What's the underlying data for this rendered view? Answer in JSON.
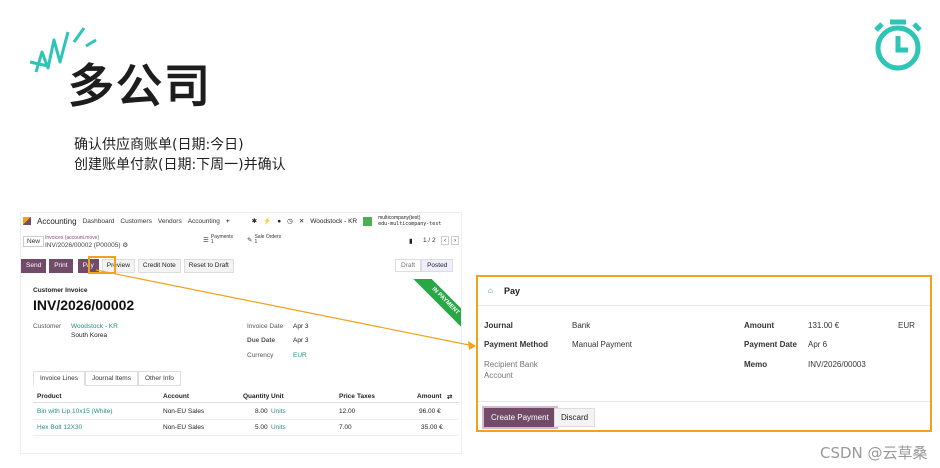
{
  "slide": {
    "title": "多公司",
    "lines": [
      "确认供应商账单(日期:今日)",
      "创建账单付款(日期:下周一)并确认"
    ],
    "watermark": "CSDN @云草桑"
  },
  "app": {
    "brand": "Accounting",
    "nav": [
      "Dashboard",
      "Customers",
      "Vendors",
      "Accounting",
      "+"
    ],
    "company": "Woodstock - KR",
    "user": "multicompany(test)",
    "db": "edu-multicompany-test"
  },
  "breadcrumb": {
    "new_label": "New",
    "parent": "Invoices (account.move)",
    "record": "INV/2026/00002 (P00005)",
    "payments_label": "Payments",
    "payments_count": "1",
    "sale_orders_label": "Sale Orders",
    "sale_orders_count": "1",
    "pager": "1 / 2"
  },
  "actions": [
    "Send",
    "Print",
    "Pay",
    "Preview",
    "Credit Note",
    "Reset to Draft"
  ],
  "statusbar": [
    "Draft",
    "Posted"
  ],
  "invoice": {
    "type": "Customer Invoice",
    "number": "INV/2026/00002",
    "ribbon": "IN PAYMENT",
    "customer_label": "Customer",
    "customer": "Woodstock - KR",
    "customer_addr": "South Korea",
    "invoice_date_label": "Invoice Date",
    "invoice_date": "Apr 3",
    "due_date_label": "Due Date",
    "due_date": "Apr 3",
    "currency_label": "Currency",
    "currency": "EUR"
  },
  "tabs": [
    "Invoice Lines",
    "Journal Items",
    "Other Info"
  ],
  "lines": {
    "headers": [
      "Product",
      "Account",
      "Quantity",
      "Unit",
      "Price",
      "Taxes",
      "Amount"
    ],
    "rows": [
      {
        "product": "Bin with Lip 10x15 (White)",
        "account": "Non-EU Sales",
        "qty": "8.00",
        "unit": "Units",
        "price": "12.00",
        "taxes": "",
        "amount": "96.00 €"
      },
      {
        "product": "Hex Bolt 12X30",
        "account": "Non-EU Sales",
        "qty": "5.00",
        "unit": "Units",
        "price": "7.00",
        "taxes": "",
        "amount": "35.00 €"
      }
    ]
  },
  "pay_dialog": {
    "title": "Pay",
    "journal_label": "Journal",
    "journal": "Bank",
    "method_label": "Payment Method",
    "method": "Manual Payment",
    "bank_label_1": "Recipient Bank",
    "bank_label_2": "Account",
    "amount_label": "Amount",
    "amount": "131.00 €",
    "currency": "EUR",
    "date_label": "Payment Date",
    "date": "Apr 6",
    "memo_label": "Memo",
    "memo": "INV/2026/00003",
    "create_label": "Create Payment",
    "discard_label": "Discard"
  },
  "colors": {
    "accent": "#714b67",
    "highlight": "#f0a21c",
    "teal": "#2ec4b6",
    "green": "#28a745"
  }
}
